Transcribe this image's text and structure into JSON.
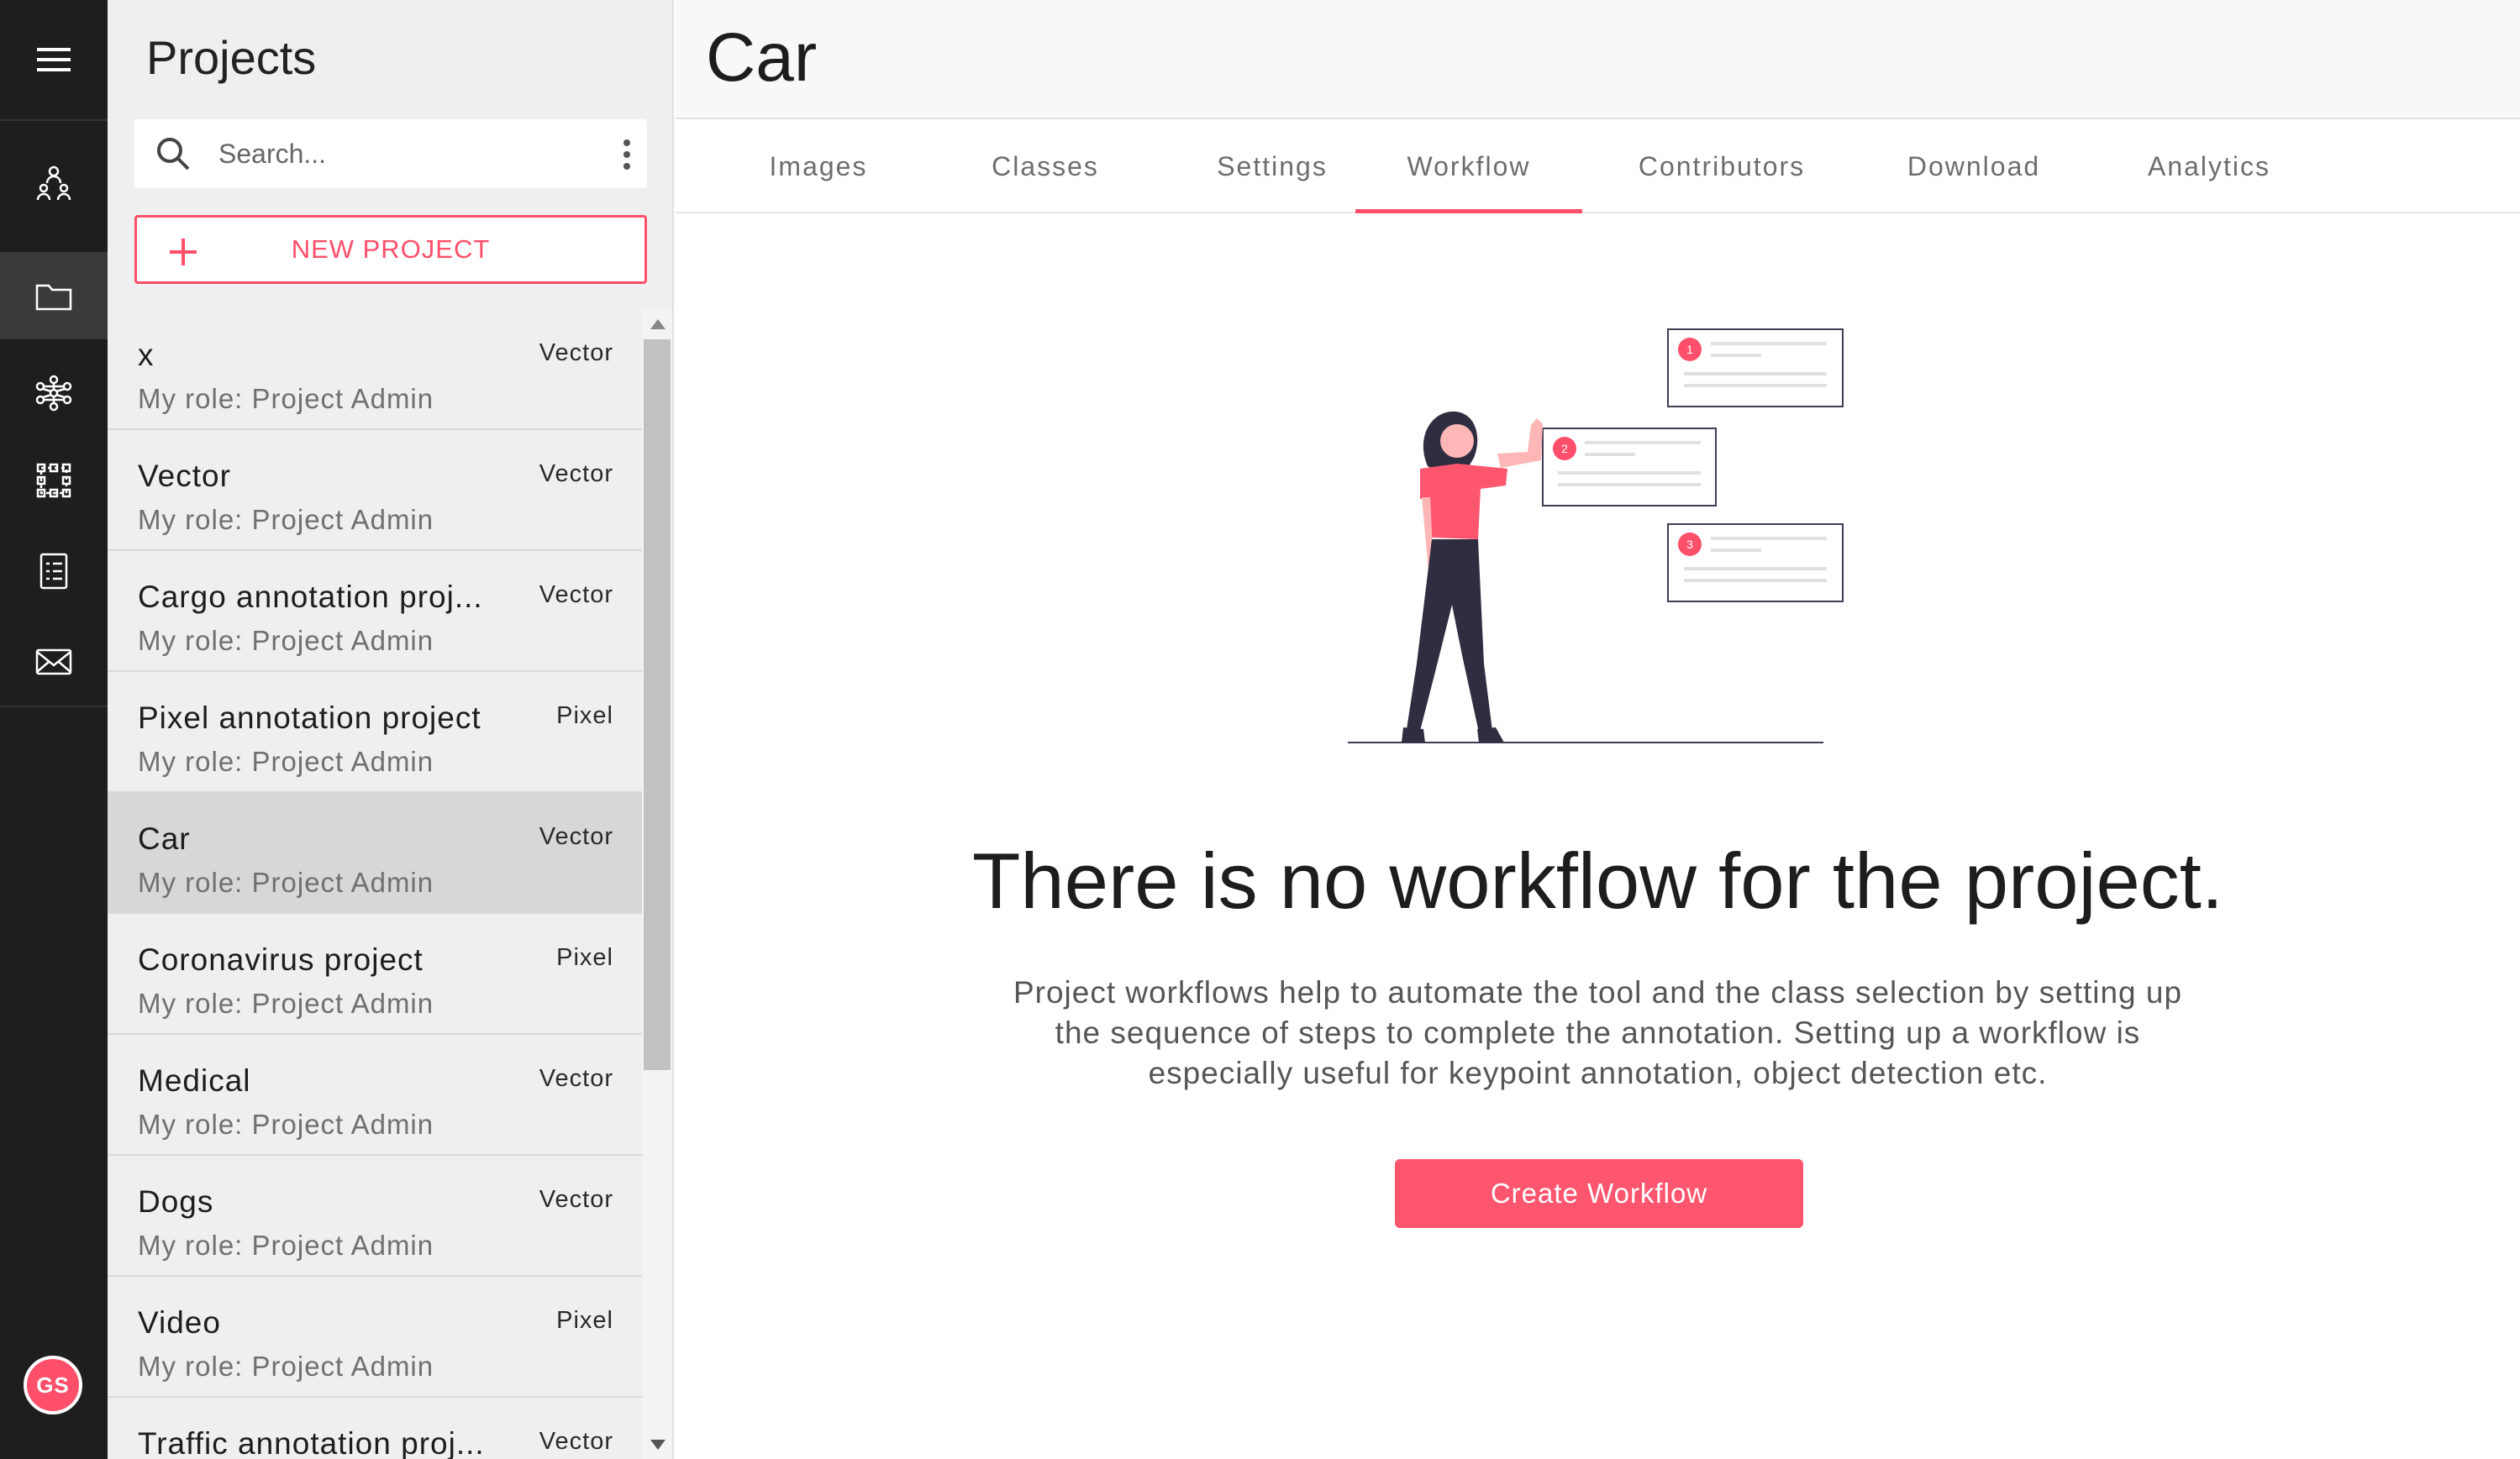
{
  "colors": {
    "accent": "#ff4f6a",
    "rail_bg": "#1e1e1e",
    "panel_bg": "#efefef"
  },
  "rail": {
    "items": [
      {
        "icon": "menu-icon"
      },
      {
        "icon": "team-icon"
      },
      {
        "icon": "folder-icon",
        "active": true
      },
      {
        "icon": "neural-network-icon"
      },
      {
        "icon": "bounding-box-icon"
      },
      {
        "icon": "task-list-icon"
      },
      {
        "icon": "mail-icon"
      }
    ],
    "avatar_initials": "GS"
  },
  "panel": {
    "title": "Projects",
    "search_placeholder": "Search...",
    "new_project_label": "NEW PROJECT",
    "projects": [
      {
        "name": "x",
        "type": "Vector",
        "role": "My role: Project Admin"
      },
      {
        "name": "Vector",
        "type": "Vector",
        "role": "My role: Project Admin"
      },
      {
        "name": "Cargo annotation proj...",
        "type": "Vector",
        "role": "My role: Project Admin"
      },
      {
        "name": "Pixel annotation project",
        "type": "Pixel",
        "role": "My role: Project Admin"
      },
      {
        "name": "Car",
        "type": "Vector",
        "role": "My role: Project Admin",
        "selected": true
      },
      {
        "name": "Coronavirus project",
        "type": "Pixel",
        "role": "My role: Project Admin"
      },
      {
        "name": "Medical",
        "type": "Vector",
        "role": "My role: Project Admin"
      },
      {
        "name": "Dogs",
        "type": "Vector",
        "role": "My role: Project Admin"
      },
      {
        "name": "Video",
        "type": "Pixel",
        "role": "My role: Project Admin"
      },
      {
        "name": "Traffic annotation proj...",
        "type": "Vector",
        "role": "My role: Project Admin"
      }
    ]
  },
  "main": {
    "project_title": "Car",
    "tabs": [
      {
        "label": "Images"
      },
      {
        "label": "Classes"
      },
      {
        "label": "Settings"
      },
      {
        "label": "Workflow",
        "active": true
      },
      {
        "label": "Contributors"
      },
      {
        "label": "Download"
      },
      {
        "label": "Analytics"
      }
    ],
    "empty_state": {
      "step_numbers": [
        "1",
        "2",
        "3"
      ],
      "headline": "There is no workflow for the project.",
      "description": "Project workflows help to automate the tool and the class selection by setting up the sequence of steps to complete the annotation. Setting up a workflow is especially useful for keypoint annotation, object detection etc.",
      "button_label": "Create Workflow"
    }
  }
}
